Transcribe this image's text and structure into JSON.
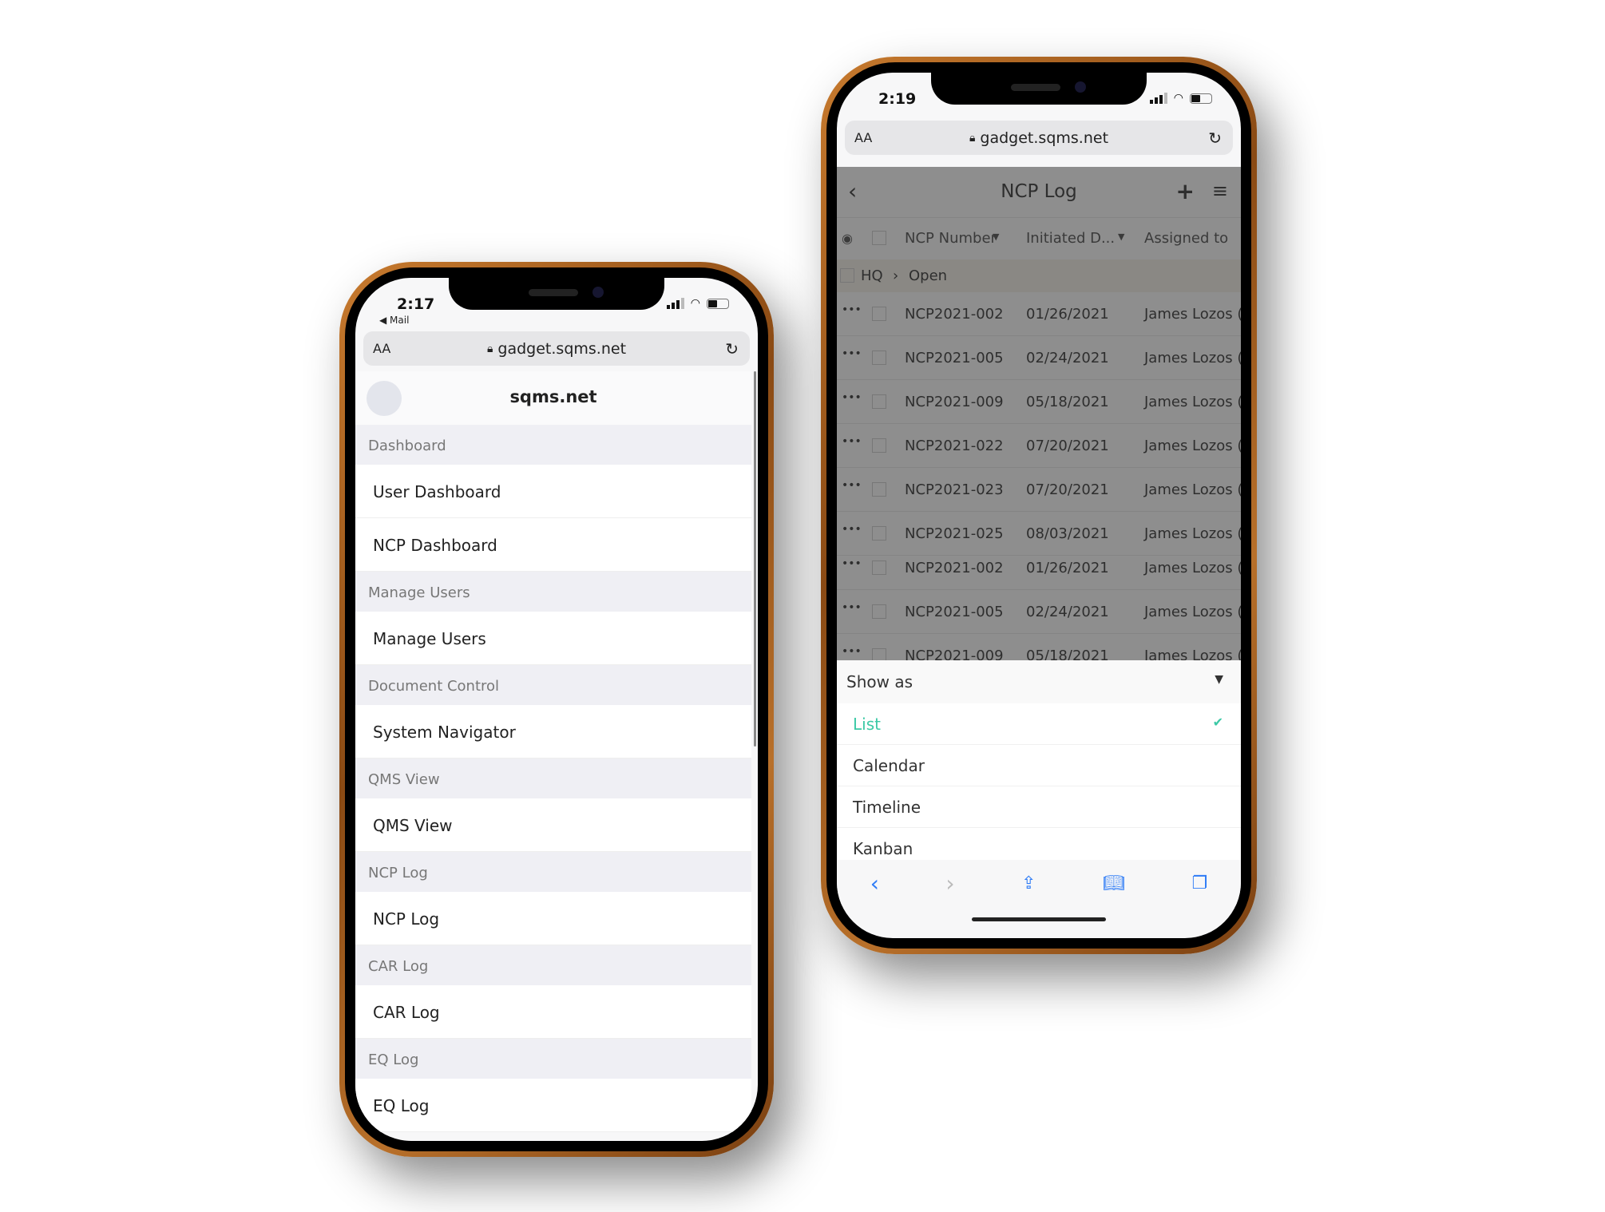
{
  "left_phone": {
    "status": {
      "time": "2:17",
      "back_app": "◀ Mail"
    },
    "url_bar": {
      "text_size": "AA",
      "domain": "gadget.sqms.net"
    },
    "header": {
      "title": "sqms.net"
    },
    "menu": [
      {
        "type": "section",
        "label": "Dashboard"
      },
      {
        "type": "item",
        "label": "User Dashboard"
      },
      {
        "type": "item",
        "label": "NCP Dashboard"
      },
      {
        "type": "section",
        "label": "Manage Users"
      },
      {
        "type": "item",
        "label": "Manage Users"
      },
      {
        "type": "section",
        "label": "Document Control"
      },
      {
        "type": "item",
        "label": "System Navigator"
      },
      {
        "type": "section",
        "label": "QMS View"
      },
      {
        "type": "item",
        "label": "QMS View"
      },
      {
        "type": "section",
        "label": "NCP Log"
      },
      {
        "type": "item",
        "label": "NCP Log"
      },
      {
        "type": "section",
        "label": "CAR Log"
      },
      {
        "type": "item",
        "label": "CAR Log"
      },
      {
        "type": "section",
        "label": "EQ Log"
      },
      {
        "type": "item",
        "label": "EQ Log"
      }
    ]
  },
  "right_phone": {
    "status": {
      "time": "2:19"
    },
    "url_bar": {
      "text_size": "AA",
      "domain": "gadget.sqms.net"
    },
    "header": {
      "title": "NCP Log"
    },
    "columns": [
      "NCP Number",
      "Initiated D...",
      "Assigned to"
    ],
    "group": {
      "parent": "HQ",
      "child": "Open"
    },
    "rows": [
      {
        "number": "NCP2021-002",
        "date": "01/26/2021",
        "assigned": "James Lozos ("
      },
      {
        "number": "NCP2021-005",
        "date": "02/24/2021",
        "assigned": "James Lozos ("
      },
      {
        "number": "NCP2021-009",
        "date": "05/18/2021",
        "assigned": "James Lozos ("
      },
      {
        "number": "NCP2021-022",
        "date": "07/20/2021",
        "assigned": "James Lozos ("
      },
      {
        "number": "NCP2021-023",
        "date": "07/20/2021",
        "assigned": "James Lozos ("
      },
      {
        "number": "NCP2021-025",
        "date": "08/03/2021",
        "assigned": "James Lozos ("
      },
      {
        "number": "NCP2021-002",
        "date": "01/26/2021",
        "assigned": "James Lozos ("
      },
      {
        "number": "NCP2021-005",
        "date": "02/24/2021",
        "assigned": "James Lozos ("
      },
      {
        "number": "NCP2021-009",
        "date": "05/18/2021",
        "assigned": "James Lozos ("
      }
    ],
    "show_as": {
      "label": "Show as",
      "options": [
        "List",
        "Calendar",
        "Timeline",
        "Kanban"
      ],
      "selected": "List",
      "accent": "#3cc9a6"
    }
  }
}
